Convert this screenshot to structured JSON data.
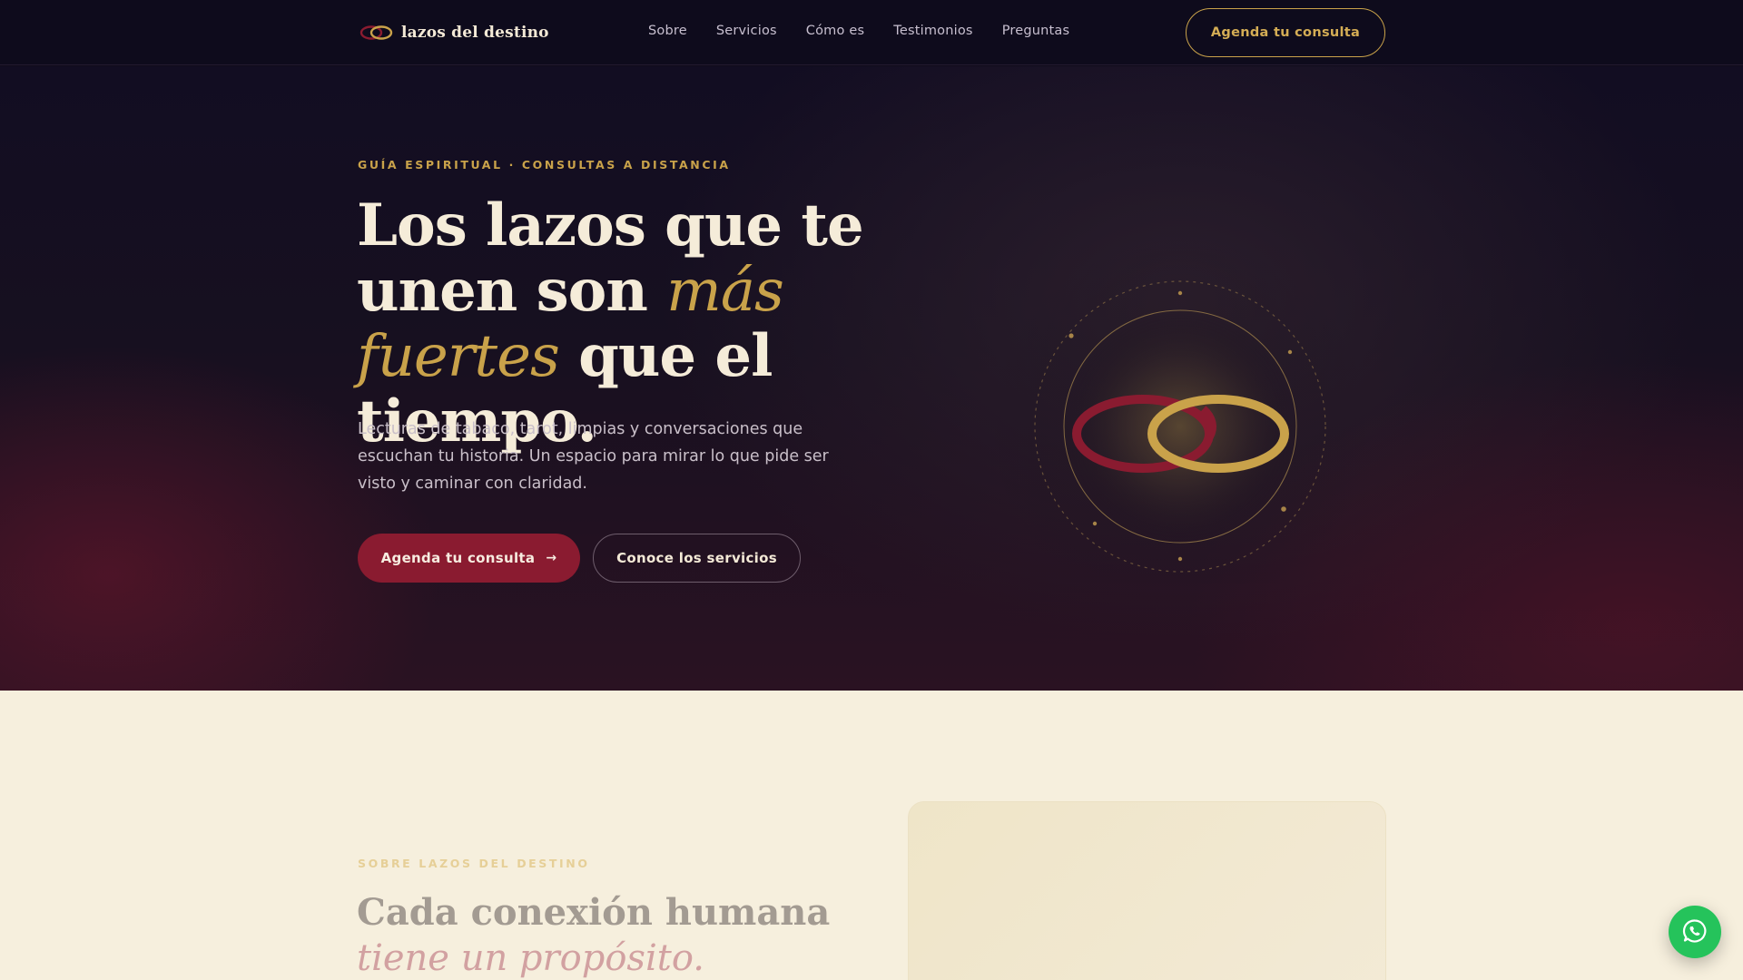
{
  "brand": {
    "name": "lazos del destino",
    "logo_icon": "interlocked-rings-icon"
  },
  "nav": {
    "links": [
      "Sobre",
      "Servicios",
      "Cómo es",
      "Testimonios",
      "Preguntas"
    ],
    "cta_label": "Agenda tu consulta"
  },
  "hero": {
    "eyebrow": "GUÍA ESPIRITUAL · CONSULTAS A DISTANCIA",
    "headline_part1": "Los lazos que te unen son ",
    "headline_accent": "más fuertes",
    "headline_part2": " que el tiempo.",
    "lead": "Lecturas de tabaco, tarot, limpias y conversaciones que escuchan tu historia. Un espacio para mirar lo que pide ser visto y caminar con claridad.",
    "primary_cta": "Agenda tu consulta",
    "primary_cta_icon": "arrow-right-icon",
    "secondary_cta": "Conoce los servicios",
    "art_icon": "interlocked-rings-icon"
  },
  "about": {
    "eyebrow": "SOBRE LAZOS DEL DESTINO",
    "title_part1": "Cada conexión humana ",
    "title_accent": "tiene un propósito."
  },
  "floating": {
    "whatsapp_icon": "whatsapp-icon"
  },
  "colors": {
    "gold": "#c9a24a",
    "crimson": "#8a1b30",
    "cream": "#f5ecd9",
    "night": "#0e0b1c",
    "whatsapp": "#25c35b"
  }
}
